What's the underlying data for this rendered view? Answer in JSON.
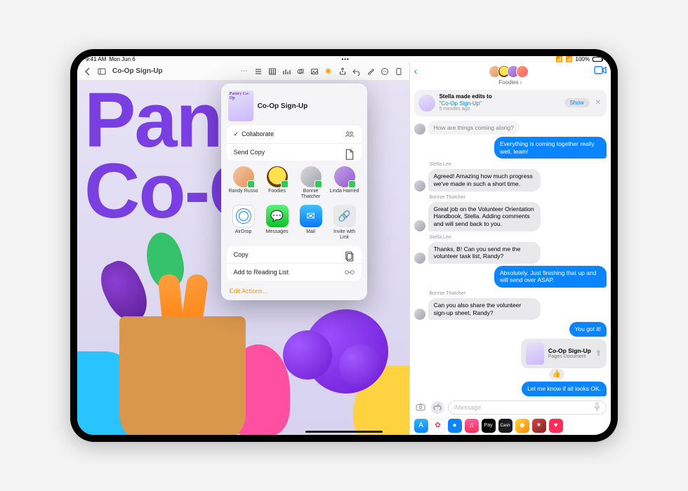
{
  "status": {
    "time": "9:41 AM",
    "date": "Mon Jun 6",
    "battery": "100%"
  },
  "pages": {
    "doc_title": "Co-Op Sign-Up",
    "poster": {
      "line1": "Pant",
      "line2": "Co-O"
    }
  },
  "share": {
    "title": "Co-Op Sign-Up",
    "thumb_text": "Pantry\nCo-Op",
    "options": {
      "collaborate": "Collaborate",
      "send_copy": "Send Copy"
    },
    "people": [
      {
        "name": "Randy Russo"
      },
      {
        "name": "Foodies"
      },
      {
        "name": "Bonnie Thatcher"
      },
      {
        "name": "Linda Hamed"
      }
    ],
    "apps": [
      {
        "name": "AirDrop"
      },
      {
        "name": "Messages"
      },
      {
        "name": "Mail"
      },
      {
        "name": "Invite with Link"
      }
    ],
    "actions": {
      "copy": "Copy",
      "reading_list": "Add to Reading List"
    },
    "edit": "Edit Actions…"
  },
  "messages": {
    "group_name": "Foodies",
    "banner": {
      "who": "Stella made edits to",
      "doc": "\"Co-Op Sign-Up\"",
      "time": "5 minutes ago",
      "show": "Show"
    },
    "thread": [
      {
        "kind": "recv_cut",
        "text": "How are things coming along?"
      },
      {
        "kind": "sent",
        "text": "Everything is coming together really well, team!"
      },
      {
        "kind": "label",
        "text": "Stella Lee"
      },
      {
        "kind": "recv",
        "text": "Agreed! Amazing how much progress we've made in such a short time."
      },
      {
        "kind": "label",
        "text": "Bonnie Thatcher"
      },
      {
        "kind": "recv",
        "text": "Great job on the Volunteer Orientation Handbook, Stella. Adding comments and will send back to you."
      },
      {
        "kind": "label",
        "text": "Stella Lee"
      },
      {
        "kind": "recv",
        "text": "Thanks, B! Can you send me the volunteer task list, Randy?"
      },
      {
        "kind": "sent",
        "text": "Absolutely. Just finishing that up and will send over ASAP."
      },
      {
        "kind": "label",
        "text": "Bonnie Thatcher"
      },
      {
        "kind": "recv",
        "text": "Can you also share the volunteer sign-up sheet, Randy?"
      },
      {
        "kind": "sent",
        "text": "You got it!"
      }
    ],
    "attachment": {
      "title": "Co-Op Sign-Up",
      "subtitle": "Pages Document"
    },
    "last_sent": "Let me know if all looks OK.",
    "input_placeholder": "iMessage"
  }
}
